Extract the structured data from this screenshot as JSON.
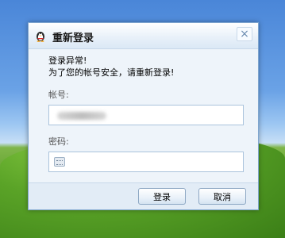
{
  "dialog": {
    "title": "重新登录",
    "close_glyph": "×",
    "message_line1": "登录异常!",
    "message_line2": "为了您的帐号安全，请重新登录!",
    "account_label": "帐号:",
    "account_value": "",
    "password_label": "密码:",
    "password_value": "",
    "login_button": "登录",
    "cancel_button": "取消"
  },
  "icons": {
    "app": "qq-penguin-icon",
    "close": "close-icon",
    "keyboard": "keyboard-icon"
  }
}
